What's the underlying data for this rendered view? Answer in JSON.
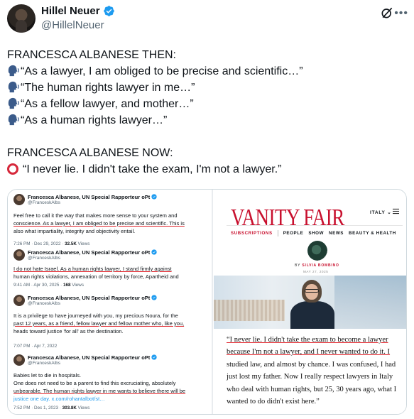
{
  "tweet": {
    "author_name": "Hillel Neuer",
    "author_handle": "@HillelNeuer",
    "lines": [
      "FRANCESCA ALBANESE THEN:",
      "“As a lawyer, I am obliged to be precise and scientific…”",
      "“The human rights lawyer in me…”",
      "“As a fellow lawyer, and mother…”",
      "“As a human rights lawyer…”",
      "FRANCESCA ALBANESE NOW:",
      "“I never lie. I didn't take the exam, I'm not a lawyer.”"
    ],
    "icons": {
      "verified": "verified-badge-icon",
      "grok": "grok-icon",
      "more": "more-options-icon",
      "speaking": "speaking-head-icon",
      "circle": "red-circle-icon"
    },
    "colors": {
      "verified": "#1d9bf0",
      "red_circle": "#d6283b",
      "secondary_text": "#536471"
    }
  },
  "media": {
    "quoted_tweets": [
      {
        "name": "Francesca Albanese, UN Special Rapporteur oPt",
        "handle": "@FranceskAlbs",
        "lines": [
          "Feel free to call it the way that makes more sense to your system and",
          "conscience. As a lawyer, I am obliged to be precise and scientific. This is",
          "also what impartiality, integrity and objectivity entail."
        ],
        "meta_time": "7:26 PM · Dec 29, 2022 · ",
        "meta_views": "32.5K",
        "meta_suffix": " Views"
      },
      {
        "name": "Francesca Albanese, UN Special Rapporteur oPt",
        "handle": "@FranceskAlbs",
        "lines": [
          "I do not hate Israel. As a human rights lawyer, I stand firmly against",
          "human rights violations, annexation of territory by force, Apartheid and"
        ],
        "meta_time": "9:41 AM · Apr 30, 2025 · ",
        "meta_views": "168",
        "meta_suffix": " Views"
      },
      {
        "name": "Francesca Albanese, UN Special Rapporteur oPt",
        "handle": "@FranceskAlbs",
        "lines": [
          "It is a privilege to have journeyed with you, my precious Noura, for the",
          "past 12 years, as a friend, fellow lawyer and fellow mother who, like you,",
          "heads toward justice 'for all' as the destination."
        ],
        "meta_time": "7:07 PM · Apr 7, 2022",
        "meta_views": "",
        "meta_suffix": ""
      },
      {
        "name": "Francesca Albanese, UN Special Rapporteur oPt",
        "handle": "@FranceskAlbs",
        "lines": [
          "Babies let to die in hospitals.",
          "One does not need to be a parent to find this excruciating, absolutely",
          "unbearable. The human rights lawyer in me wants to believe there will be",
          "justice one day. x.com/rohantalbot/st…"
        ],
        "meta_time": "7:52 PM · Dec 1, 2023 · ",
        "meta_views": "303.8K",
        "meta_suffix": " Views"
      }
    ],
    "vanity_fair": {
      "logo": "VANITY FAIR",
      "region": "ITALY",
      "nav": [
        "SUBSCRIPTIONS",
        "PEOPLE",
        "SHOW",
        "NEWS",
        "BEAUTY & HEALTH"
      ],
      "byline_prefix": "BY ",
      "byline_author": "SILVIA BOMBINO",
      "date": "MAY 27, 2025",
      "quote_lines": [
        "“I never lie. I didn't take the exam to become a lawyer",
        "because I'm not a lawyer, and I never wanted to do it. I",
        "studied law, and almost by chance. I was confused, I had",
        "just lost my father. Now I really respect lawyers in Italy",
        "who deal with human rights, but 25, 30 years ago, what I",
        "wanted to do didn't exist here.”"
      ],
      "colors": {
        "brand_red": "#c8102e"
      }
    }
  }
}
